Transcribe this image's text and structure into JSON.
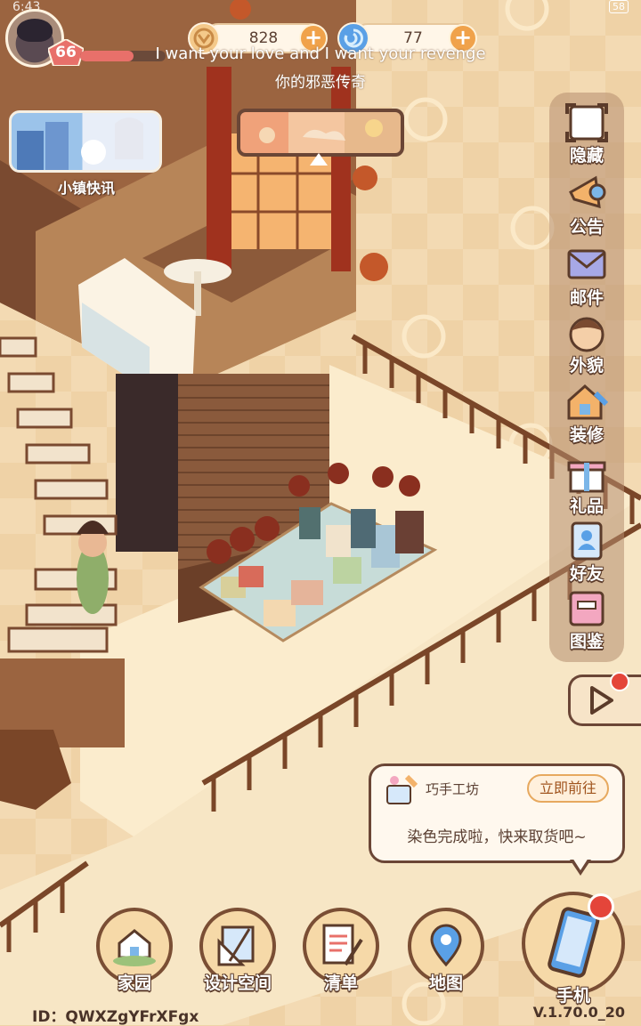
{
  "status_bar": {
    "time": "6:43",
    "battery": "58"
  },
  "player": {
    "level": "66",
    "hp_fraction": 0.62
  },
  "currency": {
    "gold": {
      "value": "828",
      "icon": "gold-coin-icon"
    },
    "gems": {
      "value": "77",
      "icon": "blue-swirl-gem-icon"
    }
  },
  "subtitles": {
    "line1": "I want your love and I want your revenge",
    "line2": "你的邪恶传奇"
  },
  "town_news": {
    "label": "小镇快讯"
  },
  "side_menu": [
    {
      "label": "隐藏",
      "icon": "hide-frame-icon"
    },
    {
      "label": "公告",
      "icon": "megaphone-icon"
    },
    {
      "label": "邮件",
      "icon": "mail-envelope-icon"
    },
    {
      "label": "外貌",
      "icon": "character-face-icon"
    },
    {
      "label": "装修",
      "icon": "house-wrench-icon"
    },
    {
      "label": "礼品",
      "icon": "gift-box-icon"
    },
    {
      "label": "好友",
      "icon": "friends-contact-icon"
    },
    {
      "label": "图鉴",
      "icon": "collection-book-icon"
    }
  ],
  "notification": {
    "title": "巧手工坊",
    "button": "立即前往",
    "message": "染色完成啦，快来取货吧~"
  },
  "bottom_nav": [
    {
      "label": "家园",
      "icon": "home-icon"
    },
    {
      "label": "设计空间",
      "icon": "design-ruler-icon"
    },
    {
      "label": "清单",
      "icon": "list-quill-icon"
    },
    {
      "label": "地图",
      "icon": "map-pin-icon"
    }
  ],
  "phone": {
    "label": "手机",
    "icon": "phone-icon"
  },
  "footer": {
    "player_id": "ID：QWXZgYFrXFgx",
    "version": "V.1.70.0_20"
  },
  "colors": {
    "accent_orange": "#f0a24a",
    "outline_brown": "#6b4636",
    "badge_red": "#e4453a"
  }
}
